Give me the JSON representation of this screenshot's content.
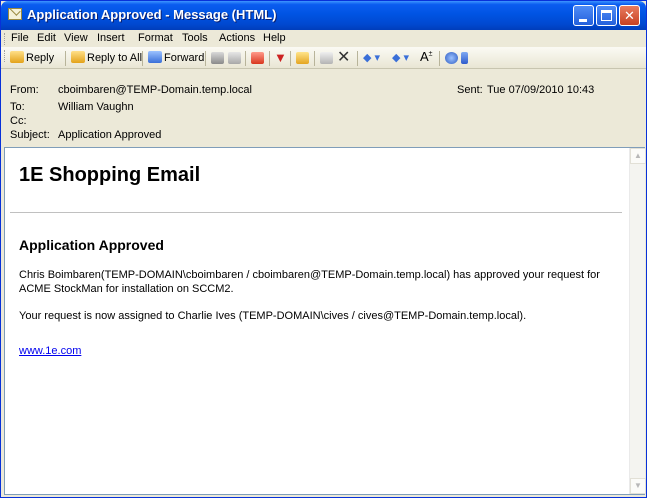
{
  "window": {
    "title": "Application Approved - Message (HTML)"
  },
  "menu": {
    "items": [
      "File",
      "Edit",
      "View",
      "Insert",
      "Format",
      "Tools",
      "Actions",
      "Help"
    ]
  },
  "toolbar": {
    "reply_label": "Reply",
    "reply_all_label": "Reply to All",
    "forward_label": "Forward",
    "font_glyph": "A"
  },
  "header": {
    "from_label": "From:",
    "from_value": "cboimbaren@TEMP-Domain.temp.local",
    "sent_label": "Sent:",
    "sent_value": "Tue 07/09/2010 10:43",
    "to_label": "To:",
    "to_value": "William Vaughn",
    "cc_label": "Cc:",
    "cc_value": "",
    "subject_label": "Subject:",
    "subject_value": "Application Approved"
  },
  "message": {
    "title": "1E Shopping Email",
    "heading": "Application Approved",
    "paragraph1": "Chris Boimbaren(TEMP-DOMAIN\\cboimbaren / cboimbaren@TEMP-Domain.temp.local) has approved your request for ACME StockMan for installation on SCCM2.",
    "paragraph2": "Your request is now assigned to Charlie Ives (TEMP-DOMAIN\\cives / cives@TEMP-Domain.temp.local).",
    "link": "www.1e.com"
  },
  "colors": {
    "titlebar": "#0054e3",
    "chrome": "#ece9d8",
    "link": "#0000ee"
  }
}
